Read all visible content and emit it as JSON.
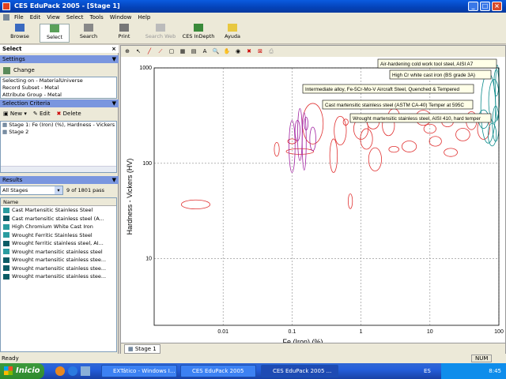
{
  "window": {
    "title": "CES EduPack 2005 - [Stage 1]"
  },
  "menu": [
    "File",
    "Edit",
    "View",
    "Select",
    "Tools",
    "Window",
    "Help"
  ],
  "toolbar": {
    "browse": "Browse",
    "select": "Select",
    "search": "Search",
    "print": "Print",
    "search_web": "Search Web",
    "indepth": "CES InDepth",
    "help": "Ayuda"
  },
  "settings": {
    "header": "Settings",
    "change": "Change",
    "lines": [
      "Selecting on - MaterialUniverse",
      "Record Subset - Metal",
      "Attribute Group - Metal"
    ]
  },
  "criteria": {
    "header": "Selection Criteria",
    "new": "New",
    "edit": "Edit",
    "delete": "Delete",
    "stages": [
      "Stage 1: Fe (Iron) (%), Hardness - Vickers (",
      "Stage 2"
    ]
  },
  "results": {
    "header": "Results",
    "filter": "All Stages",
    "count": "9 of 1801 pass",
    "col_name": "Name",
    "items": [
      "Cast Martensitic Stainless Steel",
      "Cast martensitic stainless steel (A...",
      "High Chromium White Cast Iron",
      "Wrought Ferritic Stainless Steel",
      "Wrought ferritic stainless steel, AI...",
      "Wrought martensitic stainless steel",
      "Wrought martensitic stainless stee...",
      "Wrought martensitic stainless stee...",
      "Wrought martensitic stainless stee..."
    ]
  },
  "chart_data": {
    "type": "scatter",
    "xlabel": "Fe (Iron) (%)",
    "ylabel": "Hardness - Vickers (HV)",
    "x_scale": "log",
    "y_scale": "log",
    "xlim": [
      0.001,
      100
    ],
    "ylim": [
      2,
      1000
    ],
    "x_ticks": [
      "0.01",
      "0.1",
      "1",
      "10",
      "100"
    ],
    "y_ticks": [
      "10",
      "100",
      "1000"
    ],
    "grid": true,
    "annotations": [
      "Air-hardening cold work tool steel, AISI A7",
      "High Cr white cast iron (BS grade 3A)",
      "Intermediate alloy, Fe-5Cr-Mo-V Aircraft Steel, Quenched & Tempered",
      "Cast martensitic stainless steel (ASTM CA-40) Temper at 595C",
      "Wrought martensitic stainless steel, AISI 410, hard temper"
    ],
    "series": [
      {
        "color": "#e03030",
        "ellipses": [
          [
            0.004,
            37,
            0.0025,
            0.0065,
            33,
            41
          ],
          [
            0.13,
            133,
            0.08,
            0.2,
            124,
            142
          ],
          [
            0.06,
            140,
            0.055,
            0.065,
            118,
            165
          ],
          [
            0.1,
            170,
            0.09,
            0.12,
            160,
            180
          ],
          [
            0.2,
            260,
            0.15,
            0.3,
            150,
            400
          ],
          [
            0.5,
            220,
            0.4,
            0.6,
            160,
            320
          ],
          [
            0.4,
            120,
            0.35,
            0.45,
            80,
            180
          ],
          [
            1,
            230,
            0.8,
            1.3,
            180,
            300
          ],
          [
            1.2,
            180,
            1,
            1.5,
            140,
            230
          ],
          [
            1.6,
            110,
            1.3,
            2,
            80,
            140
          ],
          [
            1.5,
            270,
            1.2,
            1.8,
            230,
            320
          ],
          [
            2.5,
            250,
            2,
            3,
            200,
            330
          ],
          [
            3,
            320,
            2.5,
            3.6,
            280,
            380
          ],
          [
            5,
            150,
            4,
            6.5,
            130,
            170
          ],
          [
            8,
            300,
            6,
            10,
            250,
            360
          ],
          [
            12,
            170,
            10,
            15,
            150,
            190
          ],
          [
            18,
            270,
            15,
            22,
            240,
            300
          ],
          [
            30,
            200,
            25,
            40,
            170,
            230
          ],
          [
            20,
            130,
            16,
            25,
            115,
            140
          ],
          [
            40,
            280,
            35,
            50,
            220,
            340
          ],
          [
            60,
            230,
            50,
            75,
            180,
            300
          ],
          [
            10,
            230,
            8,
            12,
            200,
            250
          ],
          [
            3,
            140,
            2.5,
            3.5,
            130,
            150
          ],
          [
            0.7,
            40,
            0.65,
            0.75,
            35,
            50
          ],
          [
            0.6,
            270,
            0.55,
            0.65,
            250,
            290
          ]
        ]
      },
      {
        "color": "#a020a0",
        "ellipses": [
          [
            0.1,
            150,
            0.09,
            0.11,
            80,
            280
          ],
          [
            0.13,
            200,
            0.12,
            0.14,
            100,
            350
          ],
          [
            0.15,
            170,
            0.14,
            0.16,
            80,
            320
          ],
          [
            0.12,
            220,
            0.11,
            0.13,
            170,
            280
          ],
          [
            0.16,
            260,
            0.15,
            0.17,
            220,
            300
          ],
          [
            0.2,
            180,
            0.18,
            0.22,
            130,
            230
          ]
        ]
      },
      {
        "color": "#0e8c8c",
        "ellipses": [
          [
            70,
            380,
            55,
            90,
            150,
            820
          ],
          [
            85,
            450,
            70,
            100,
            300,
            850
          ],
          [
            90,
            260,
            80,
            100,
            170,
            400
          ],
          [
            95,
            550,
            88,
            100,
            250,
            950
          ],
          [
            80,
            200,
            70,
            92,
            150,
            260
          ],
          [
            60,
            290,
            50,
            70,
            230,
            360
          ],
          [
            92,
            700,
            85,
            100,
            500,
            950
          ]
        ]
      }
    ]
  },
  "chart_tab": "Stage 1",
  "status": {
    "left": "Ready",
    "num": "NUM"
  },
  "taskbar": {
    "start": "Inicio",
    "tasks": [
      "EXTático - Windows I...",
      "CES EduPack 2005",
      "CES EduPack 2005 ..."
    ],
    "lang": "ES",
    "clock": "8:45"
  }
}
